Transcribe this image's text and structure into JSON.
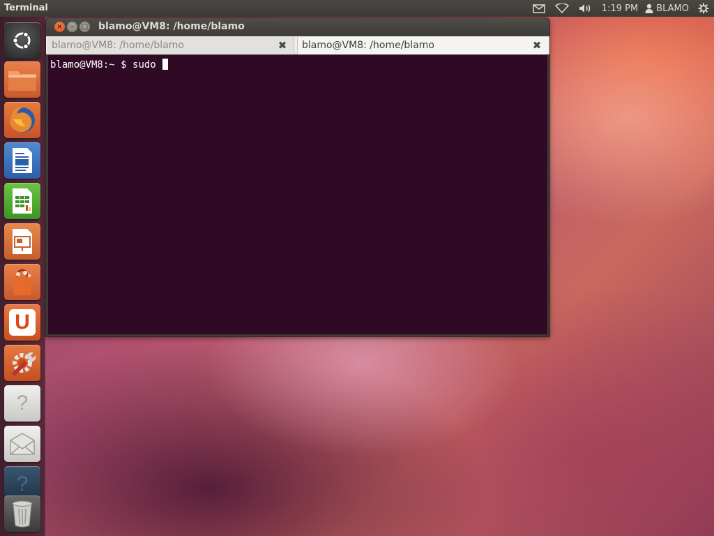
{
  "top_panel": {
    "app_title": "Terminal",
    "clock": "1:19 PM",
    "user": "BLAMO",
    "indicators": [
      "mail-icon",
      "wifi-icon",
      "volume-icon",
      "user-icon",
      "gear-icon"
    ]
  },
  "launcher": {
    "items": [
      {
        "name": "dash-home",
        "icon": "ubuntu-logo-icon"
      },
      {
        "name": "home-folder",
        "icon": "folder-icon"
      },
      {
        "name": "firefox",
        "icon": "firefox-icon"
      },
      {
        "name": "libreoffice-writer",
        "icon": "writer-icon"
      },
      {
        "name": "libreoffice-calc",
        "icon": "calc-icon"
      },
      {
        "name": "libreoffice-impress",
        "icon": "impress-icon"
      },
      {
        "name": "software-center",
        "icon": "shopping-bag-icon"
      },
      {
        "name": "ubuntu-one",
        "icon": "ubuntu-one-icon"
      },
      {
        "name": "system-settings",
        "icon": "settings-wrench-icon"
      },
      {
        "name": "help",
        "icon": "help-icon"
      },
      {
        "name": "mail-client",
        "icon": "envelope-icon"
      },
      {
        "name": "help-dark",
        "icon": "help-icon"
      },
      {
        "name": "trash",
        "icon": "trash-icon"
      }
    ],
    "glyphs": {
      "help": "?",
      "ubuntu_one": "U"
    }
  },
  "window": {
    "title": "blamo@VM8: /home/blamo",
    "buttons": {
      "close": "×",
      "minimize": "–",
      "maximize": "□"
    },
    "tabs": [
      {
        "label": "blamo@VM8: /home/blamo",
        "active": false,
        "close": "✖"
      },
      {
        "label": "blamo@VM8: /home/blamo",
        "active": true,
        "close": "✖"
      }
    ],
    "terminal": {
      "prompt": "blamo@VM8:~ $ ",
      "command": "sudo ",
      "background": "#300a24"
    }
  },
  "colors": {
    "panel": "#3c3b37",
    "accent": "#dd4814",
    "terminal_bg": "#300a24"
  }
}
